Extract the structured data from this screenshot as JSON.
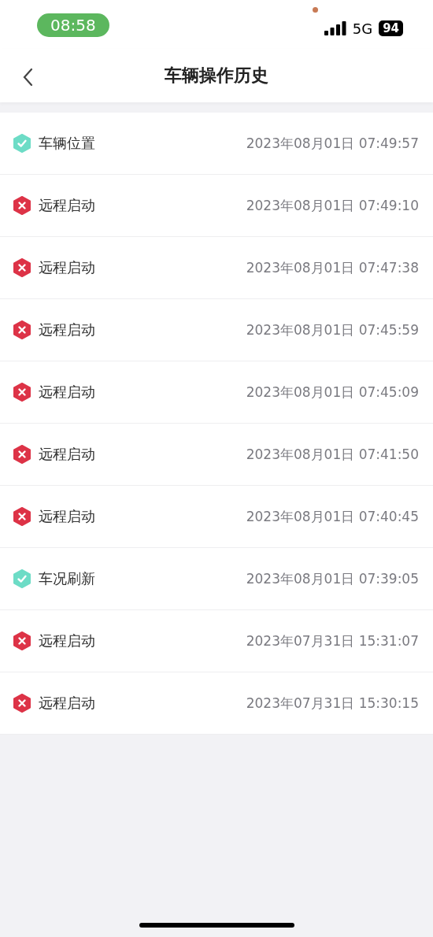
{
  "status_bar": {
    "time": "08:58",
    "network": "5G",
    "battery": "94"
  },
  "nav": {
    "title": "车辆操作历史"
  },
  "records": [
    {
      "action": "车辆位置",
      "time": "2023年08月01日 07:49:57",
      "kind": "success"
    },
    {
      "action": "远程启动",
      "time": "2023年08月01日 07:49:10",
      "kind": "failure"
    },
    {
      "action": "远程启动",
      "time": "2023年08月01日 07:47:38",
      "kind": "failure"
    },
    {
      "action": "远程启动",
      "time": "2023年08月01日 07:45:59",
      "kind": "failure"
    },
    {
      "action": "远程启动",
      "time": "2023年08月01日 07:45:09",
      "kind": "failure"
    },
    {
      "action": "远程启动",
      "time": "2023年08月01日 07:41:50",
      "kind": "failure"
    },
    {
      "action": "远程启动",
      "time": "2023年08月01日 07:40:45",
      "kind": "failure"
    },
    {
      "action": "车况刷新",
      "time": "2023年08月01日 07:39:05",
      "kind": "success"
    },
    {
      "action": "远程启动",
      "time": "2023年07月31日 15:31:07",
      "kind": "failure"
    },
    {
      "action": "远程启动",
      "time": "2023年07月31日 15:30:15",
      "kind": "failure"
    }
  ]
}
